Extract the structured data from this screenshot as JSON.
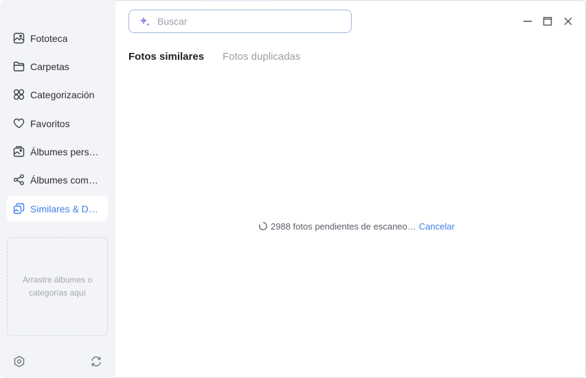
{
  "sidebar": {
    "items": [
      {
        "label": "Fototeca",
        "icon": "photo-library-icon"
      },
      {
        "label": "Carpetas",
        "icon": "folder-icon"
      },
      {
        "label": "Categorización",
        "icon": "grid-categories-icon"
      },
      {
        "label": "Favoritos",
        "icon": "heart-icon"
      },
      {
        "label": "Álbumes personales",
        "icon": "personal-album-icon"
      },
      {
        "label": "Álbumes compartidos",
        "icon": "share-icon"
      },
      {
        "label": "Similares & Duplicadas",
        "icon": "similar-photos-icon",
        "active": true
      }
    ],
    "dropzone_text": "Arrastre álbumes o categorías aquí",
    "bottom": {
      "settings_icon": "settings-hex-icon",
      "sync_icon": "refresh-icon"
    }
  },
  "search": {
    "placeholder": "Buscar",
    "value": "",
    "icon": "ai-sparkle-icon"
  },
  "window_controls": {
    "minimize": "minimize-icon",
    "maximize": "maximize-icon",
    "close": "close-icon"
  },
  "tabs": [
    {
      "label": "Fotos similares",
      "active": true
    },
    {
      "label": "Fotos duplicadas",
      "active": false
    }
  ],
  "status": {
    "message": "2988 fotos pendientes de escaneo…",
    "cancel_label": "Cancelar",
    "icon": "loading-spinner-icon"
  },
  "colors": {
    "accent": "#3f7ee8",
    "sidebar_bg": "#f3f4f8",
    "search_border": "#9fb4dc"
  }
}
